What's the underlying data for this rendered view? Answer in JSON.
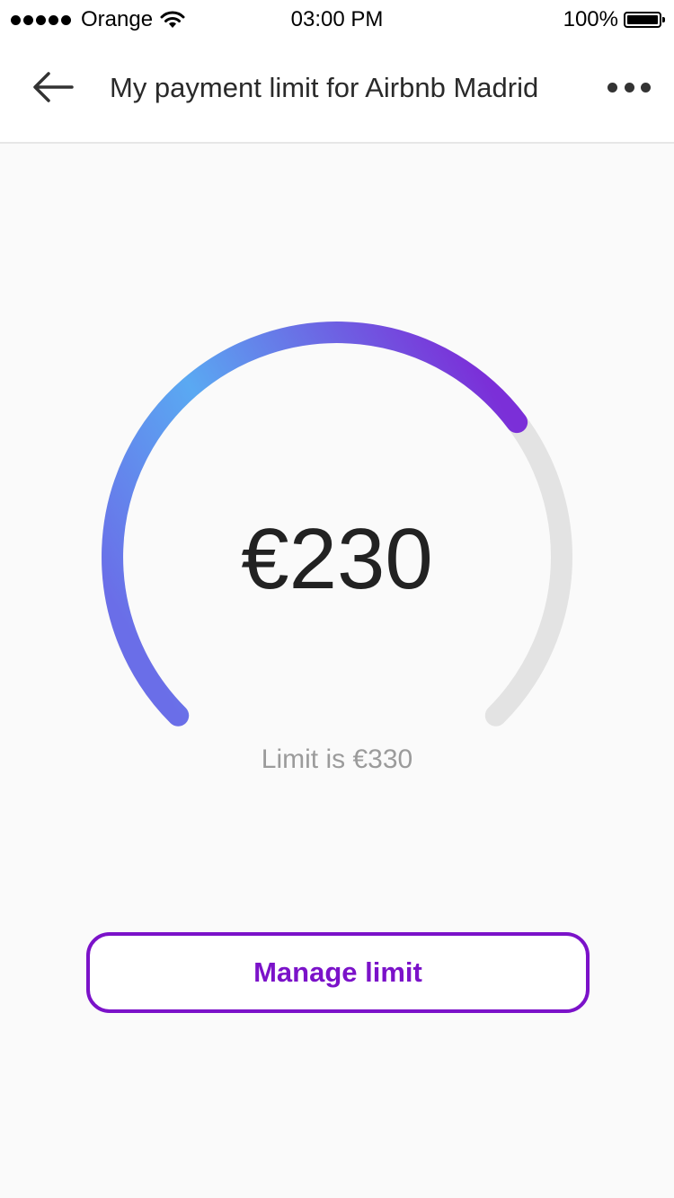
{
  "status_bar": {
    "carrier": "Orange",
    "time": "03:00 PM",
    "battery": "100%"
  },
  "nav": {
    "title": "My payment limit for Airbnb Madrid",
    "back_icon": "arrow-left-icon",
    "more_icon": "more-horizontal-icon"
  },
  "gauge": {
    "amount": "€230",
    "spent": 230,
    "limit": 330,
    "limit_text": "Limit is €330",
    "colors": {
      "track": "#e3e3e3",
      "gradient_start": "#5aa9f2",
      "gradient_end": "#7b2fd8"
    }
  },
  "actions": {
    "manage_label": "Manage limit"
  },
  "colors": {
    "accent": "#7b12c9",
    "background": "#fafafa"
  }
}
